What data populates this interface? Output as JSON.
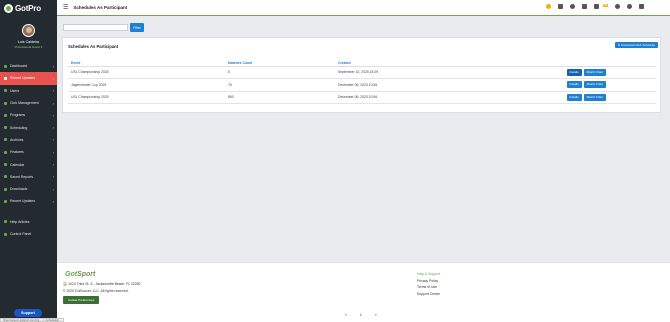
{
  "brand": {
    "logo_text": "GotPro"
  },
  "user": {
    "name": "Luis Caldeira",
    "subtitle": "Professional Guest ▾"
  },
  "nav": [
    {
      "label": "Dashboard",
      "active": false
    },
    {
      "label": "Recent Updates",
      "active": true
    },
    {
      "label": "Users",
      "active": false
    },
    {
      "label": "Club Management",
      "active": false
    },
    {
      "label": "Programs",
      "active": false
    },
    {
      "label": "Scheduling",
      "active": false
    },
    {
      "label": "Archives",
      "active": false
    },
    {
      "label": "Features",
      "active": false
    },
    {
      "label": "Calendar",
      "active": false
    },
    {
      "label": "Saved Reports",
      "active": false
    },
    {
      "label": "Downloads",
      "active": false
    },
    {
      "label": "Recent Updates",
      "active": false
    }
  ],
  "nav_bottom": [
    {
      "label": "Help Articles"
    },
    {
      "label": "Control Panel"
    }
  ],
  "support_label": "Support",
  "topbar": {
    "title": "Schedules As Participant",
    "badge": "99"
  },
  "filter": {
    "button": "Filter",
    "placeholder": ""
  },
  "card": {
    "title": "Schedules As Participant",
    "download_label": "Download Club Schedule"
  },
  "table": {
    "headers": [
      "Event",
      "Matches Count",
      "Created"
    ],
    "rows": [
      {
        "event": "USL Championship 2025",
        "count": "5",
        "created": "September 10, 2025 18:29"
      },
      {
        "event": "Jägermeister Cup 2025",
        "count": "76",
        "created": "December 06, 2023 10:56"
      },
      {
        "event": "USL Championship 2025",
        "count": "890",
        "created": "December 06, 2023 10:56"
      }
    ],
    "details_label": "Details",
    "match_chart_label": "Match Chart"
  },
  "footer": {
    "logo_got": "Got",
    "logo_sport": "Sport",
    "address": "🏠 1024 Third St. S., Jacksonville Beach, FL 32250",
    "copyright": "© 2025 GotSoccer, LLC. All rights reserved.",
    "button": "Cookie Preferences",
    "links": [
      "Help & Support",
      "Privacy Policy",
      "Terms of Use",
      "Support Center"
    ],
    "pager": [
      "«",
      "1",
      "»"
    ]
  },
  "status_url": "https://system.gotsport.com/org_.../.../schedules/..."
}
